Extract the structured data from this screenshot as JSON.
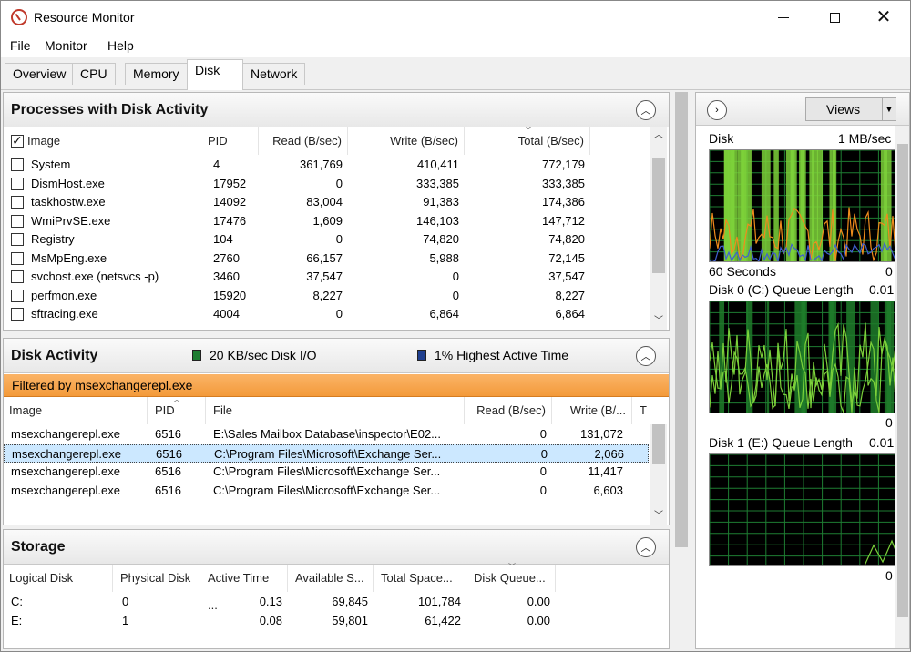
{
  "window": {
    "title": "Resource Monitor"
  },
  "menu": {
    "file": "File",
    "monitor": "Monitor",
    "help": "Help"
  },
  "tabs": [
    {
      "label": "Overview"
    },
    {
      "label": "CPU"
    },
    {
      "label": "Memory"
    },
    {
      "label": "Disk"
    },
    {
      "label": "Network"
    }
  ],
  "active_tab": "Disk",
  "processes": {
    "title": "Processes with Disk Activity",
    "columns": [
      "Image",
      "PID",
      "Read (B/sec)",
      "Write (B/sec)",
      "Total (B/sec)"
    ],
    "rows": [
      {
        "image": "System",
        "pid": "4",
        "read": "361,769",
        "write": "410,411",
        "total": "772,179"
      },
      {
        "image": "DismHost.exe",
        "pid": "17952",
        "read": "0",
        "write": "333,385",
        "total": "333,385"
      },
      {
        "image": "taskhostw.exe",
        "pid": "14092",
        "read": "83,004",
        "write": "91,383",
        "total": "174,386"
      },
      {
        "image": "WmiPrvSE.exe",
        "pid": "17476",
        "read": "1,609",
        "write": "146,103",
        "total": "147,712"
      },
      {
        "image": "Registry",
        "pid": "104",
        "read": "0",
        "write": "74,820",
        "total": "74,820"
      },
      {
        "image": "MsMpEng.exe",
        "pid": "2760",
        "read": "66,157",
        "write": "5,988",
        "total": "72,145"
      },
      {
        "image": "svchost.exe (netsvcs -p)",
        "pid": "3460",
        "read": "37,547",
        "write": "0",
        "total": "37,547"
      },
      {
        "image": "perfmon.exe",
        "pid": "15920",
        "read": "8,227",
        "write": "0",
        "total": "8,227"
      },
      {
        "image": "sftracing.exe",
        "pid": "4004",
        "read": "0",
        "write": "6,864",
        "total": "6,864"
      }
    ]
  },
  "disk_activity": {
    "title": "Disk Activity",
    "legend_io": "20 KB/sec Disk I/O",
    "legend_active": "1% Highest Active Time",
    "io_color": "#1e7d32",
    "active_color": "#1f3f8f",
    "filter": "Filtered by msexchangerepl.exe",
    "columns": [
      "Image",
      "PID",
      "File",
      "Read (B/sec)",
      "Write (B/..."
    ],
    "rows": [
      {
        "image": "msexchangerepl.exe",
        "pid": "6516",
        "file": "E:\\Sales Mailbox Database\\inspector\\E02...",
        "read": "0",
        "write": "131,072"
      },
      {
        "image": "msexchangerepl.exe",
        "pid": "6516",
        "file": "C:\\Program Files\\Microsoft\\Exchange Ser...",
        "read": "0",
        "write": "2,066"
      },
      {
        "image": "msexchangerepl.exe",
        "pid": "6516",
        "file": "C:\\Program Files\\Microsoft\\Exchange Ser...",
        "read": "0",
        "write": "11,417"
      },
      {
        "image": "msexchangerepl.exe",
        "pid": "6516",
        "file": "C:\\Program Files\\Microsoft\\Exchange Ser...",
        "read": "0",
        "write": "6,603"
      }
    ]
  },
  "storage": {
    "title": "Storage",
    "columns": [
      "Logical Disk",
      "Physical Disk",
      "Active Time ...",
      "Available S...",
      "Total Space...",
      "Disk Queue..."
    ],
    "rows": [
      {
        "logical": "C:",
        "physical": "0",
        "active": "0.13",
        "available": "69,845",
        "total": "101,784",
        "queue": "0.00"
      },
      {
        "logical": "E:",
        "physical": "1",
        "active": "0.08",
        "available": "59,801",
        "total": "61,422",
        "queue": "0.00"
      }
    ]
  },
  "graphs": {
    "views_label": "Views",
    "disk_label": "Disk",
    "disk_scale": "1 MB/sec",
    "disk_time": "60 Seconds",
    "disk_min": "0",
    "disk0_label": "Disk 0 (C:) Queue Length",
    "disk0_scale": "0.01",
    "disk0_min": "0",
    "disk1_label": "Disk 1 (E:) Queue Length",
    "disk1_scale": "0.01",
    "disk1_min": "0",
    "grid_color": "#1e7d32",
    "line_color": "#7cd13a",
    "accent_color": "#f08c1c",
    "blue_color": "#4060d0"
  }
}
